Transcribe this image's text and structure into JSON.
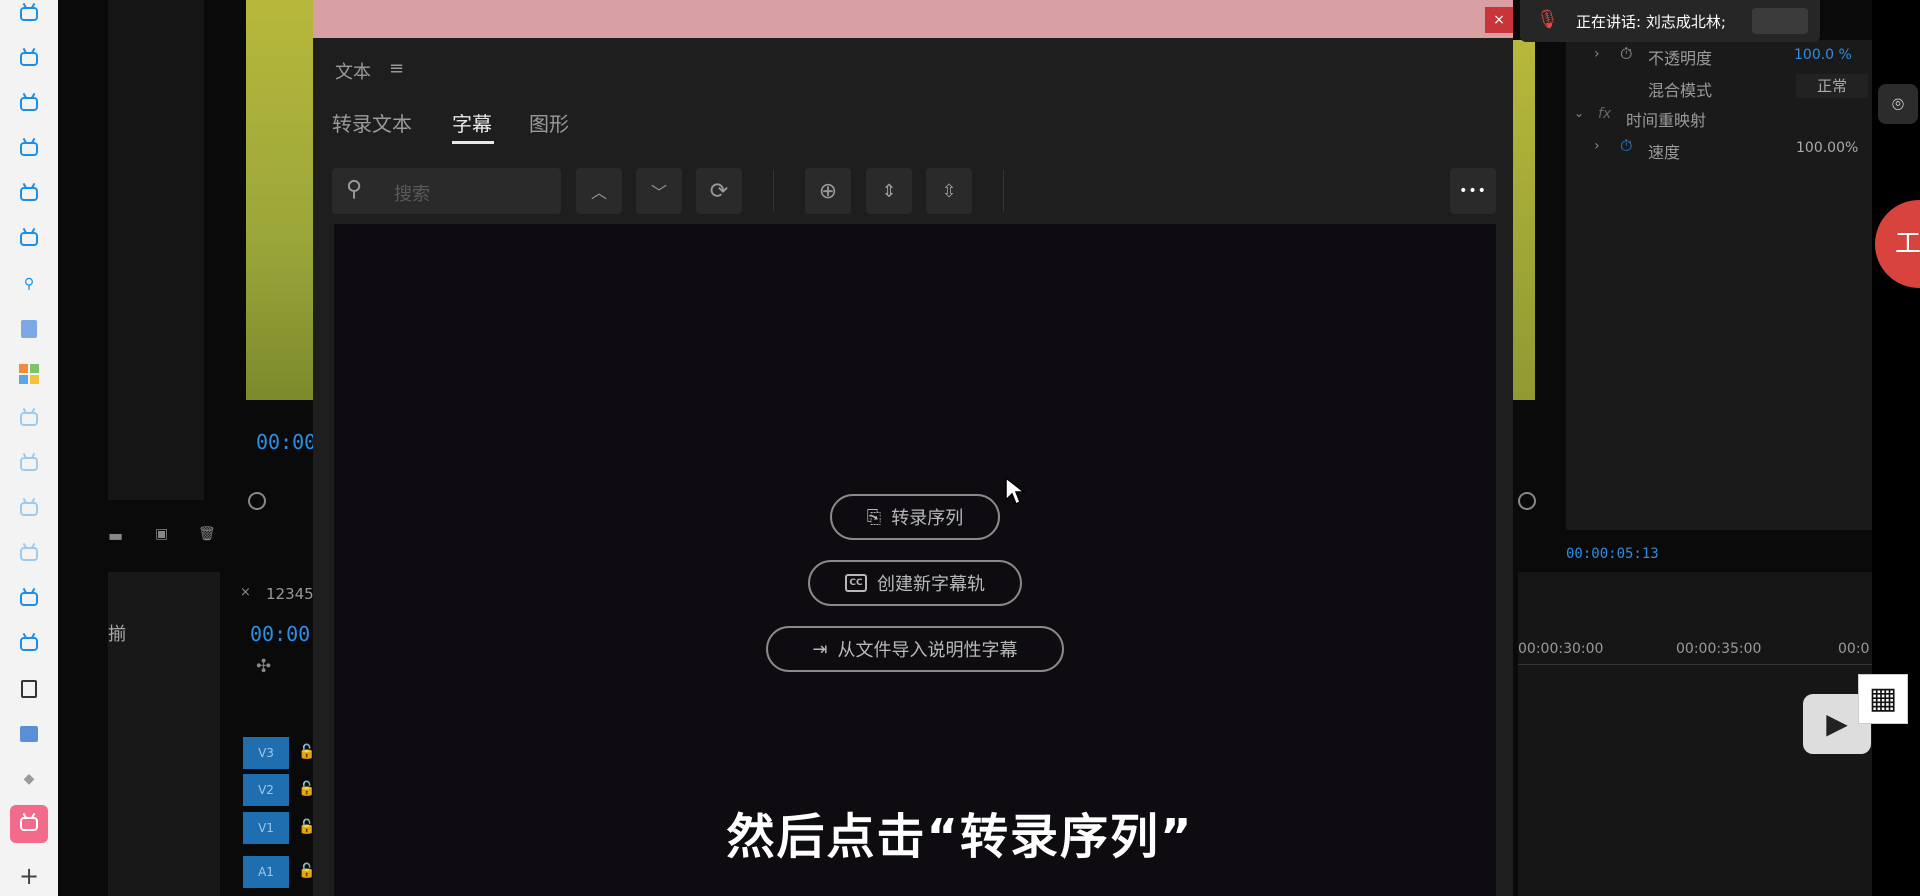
{
  "dock": {
    "items": [
      "tv",
      "tv",
      "tv",
      "tv",
      "tv",
      "tv",
      "search",
      "doc",
      "apps",
      "tv-faded",
      "tv-faded",
      "tv-faded",
      "tv-faded",
      "tv",
      "tv",
      "excel-icon",
      "calendar-icon",
      "diamond-icon",
      "tv-active"
    ]
  },
  "editor": {
    "left_timecode": "00:00",
    "timeline_timecode": "00:00",
    "sequence_name": "12345",
    "sequence_close": "×",
    "tracks": [
      "V3",
      "V2",
      "V1",
      "A1"
    ],
    "right_timecode": "00:00:05:13",
    "ruler": [
      "00:00:30:00",
      "00:00:35:00",
      "00:0"
    ],
    "props": {
      "opacity_label": "不透明度",
      "opacity_value": "100.0 %",
      "blend_label": "混合模式",
      "blend_value": "正常",
      "time_remap_label": "时间重映射",
      "speed_label": "速度",
      "speed_value": "100.00%",
      "fx_label": "fx"
    }
  },
  "modal": {
    "close_label": "×",
    "header_title": "文本",
    "menu_icon": "≡",
    "tabs": [
      "转录文本",
      "字幕",
      "图形"
    ],
    "active_tab": "字幕",
    "search_placeholder": "搜索",
    "buttons": {
      "transcribe": "转录序列",
      "new_caption_track": "创建新字幕轨",
      "import_captions": "从文件导入说明性字幕"
    },
    "more_label": "•••"
  },
  "notification": {
    "speaking": "正在讲话: 刘志成北林;"
  },
  "subtitle": "然后点击“转录序列”",
  "right_badge": "工"
}
